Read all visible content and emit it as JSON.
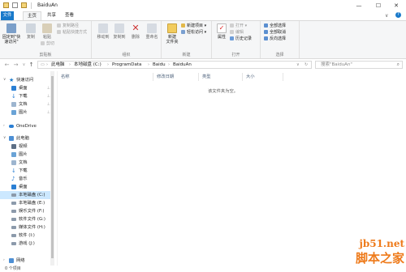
{
  "window": {
    "title": "BaiduAn",
    "controls": {
      "minimize": "—",
      "maximize": "☐",
      "close": "✕"
    }
  },
  "tabs": {
    "file": "文件",
    "home": "主页",
    "share": "共享",
    "view": "查看"
  },
  "ribbon": {
    "clipboard": {
      "group_label": "剪贴板",
      "pin_label": "固定到\"快速访问\"",
      "copy_label": "复制",
      "paste_label": "粘贴",
      "copy_path": "复制路径",
      "paste_shortcut": "粘贴快捷方式",
      "cut": "剪切"
    },
    "organize": {
      "group_label": "组织",
      "move_to": "移动到",
      "copy_to": "复制到",
      "delete": "删除",
      "rename": "重命名"
    },
    "new": {
      "group_label": "新建",
      "new_folder": "新建\n文件夹",
      "new_item": "新建项目",
      "easy_access": "轻松访问"
    },
    "open": {
      "group_label": "打开",
      "properties": "属性",
      "open": "打开",
      "edit": "编辑",
      "history": "历史记录"
    },
    "select": {
      "group_label": "选择",
      "select_all": "全部选择",
      "select_none": "全部取消",
      "invert": "反向选择"
    }
  },
  "address": {
    "crumbs": [
      "此电脑",
      "本地磁盘 (C:)",
      "ProgramData",
      "Baidu",
      "BaiduAn"
    ],
    "search_placeholder": "搜索\"BaiduAn\""
  },
  "nav": {
    "quick_access": "快速访问",
    "qa_items": [
      "桌面",
      "下载",
      "文档",
      "图片"
    ],
    "onedrive": "OneDrive",
    "this_pc": "此电脑",
    "pc_items": [
      "视频",
      "图片",
      "文档",
      "下载",
      "音乐",
      "桌面",
      "本地磁盘 (C:)",
      "本地磁盘 (E:)",
      "娱乐文件 (F:)",
      "软件文件 (G:)",
      "媒体文件 (H:)",
      "软件 (I:)",
      "游戏 (J:)"
    ],
    "network": "网络"
  },
  "columns": [
    "名称",
    "修改日期",
    "类型",
    "大小"
  ],
  "empty_message": "该文件夹为空。",
  "status": "0 个项目",
  "watermark": {
    "line1": "jb51.net",
    "line2": "脚本之家"
  },
  "colors": {
    "accent": "#1979ca",
    "selected": "#cce8ff"
  }
}
